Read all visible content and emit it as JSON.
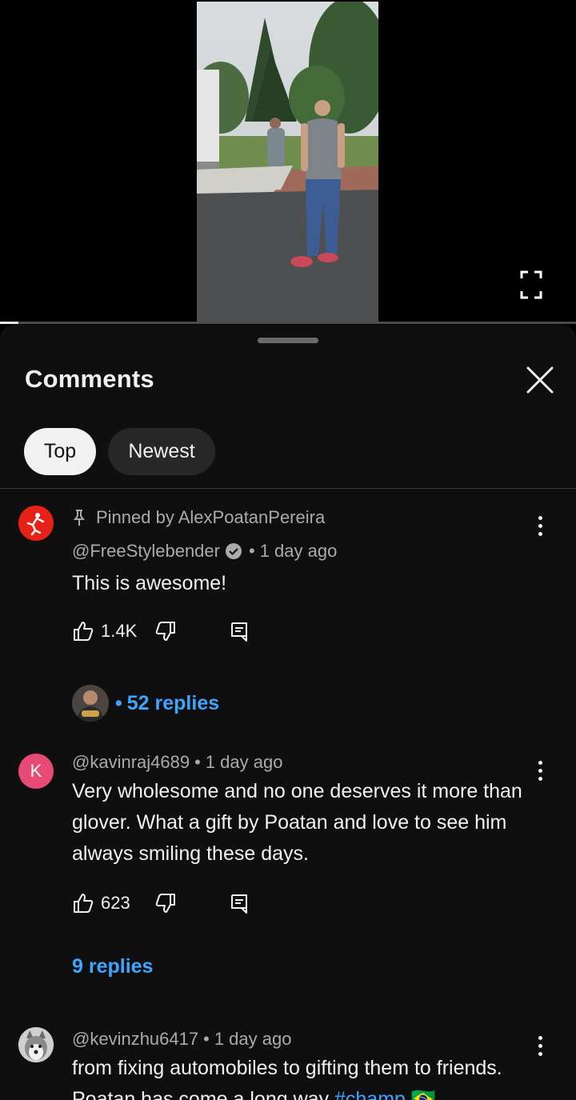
{
  "video": {
    "progress_fraction": 0.032
  },
  "panel": {
    "title": "Comments",
    "close_icon": "close-icon",
    "sort_chips": [
      {
        "label": "Top",
        "selected": true
      },
      {
        "label": "Newest",
        "selected": false
      }
    ]
  },
  "comments": [
    {
      "pinned_label": "Pinned by AlexPoatanPereira",
      "author": "@FreeStylebender",
      "verified": true,
      "separator": "•",
      "time": "1 day ago",
      "text": "This is awesome!",
      "likes": "1.4K",
      "replies": "52 replies",
      "replies_prefix": "•",
      "avatar_color": "#e62117"
    },
    {
      "author": "@kavinraj4689",
      "separator": "•",
      "time": "1 day ago",
      "text": "Very wholesome and no one deserves it more than glover. What a gift by Poatan and love to see him always smiling these days.",
      "likes": "623",
      "replies": "9 replies",
      "avatar_letter": "K",
      "avatar_color": "#e84a76"
    },
    {
      "author": "@kevinzhu6417",
      "separator": "•",
      "time": "1 day ago",
      "text": "from fixing automobiles to gifting them to friends. Poatan has come a long way",
      "hashtag": "#champ",
      "emoji": "🇧🇷"
    }
  ],
  "colors": {
    "panel_bg": "#0f0f0f",
    "link_blue": "#3ea6ff",
    "secondary_text": "#aaaaaa",
    "chip_selected_bg": "#f1f1f1",
    "chip_bg": "#272727"
  }
}
